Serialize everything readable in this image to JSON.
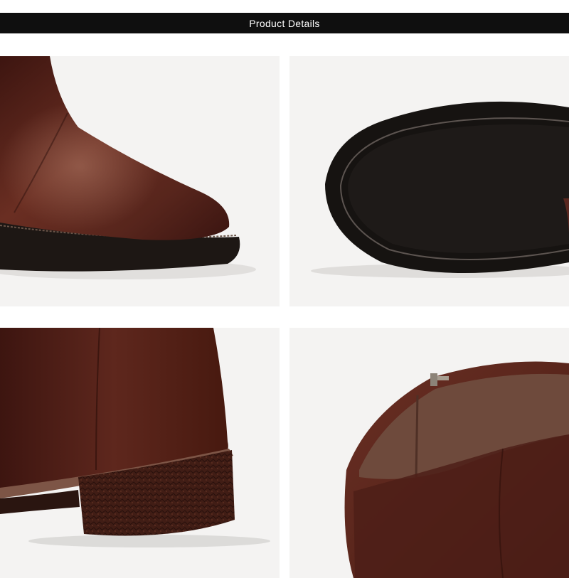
{
  "header": {
    "title": "Product Details"
  },
  "palette": {
    "background": "#ffffff",
    "header_bar": "#0f0f0f",
    "photo_background": "#f4f3f2",
    "leather_brown": "#4e1f17",
    "sole_black": "#111111"
  },
  "photos": [
    {
      "subject": "toe-closeup"
    },
    {
      "subject": "outsole"
    },
    {
      "subject": "heel-closeup"
    },
    {
      "subject": "zipper-closeup"
    }
  ]
}
